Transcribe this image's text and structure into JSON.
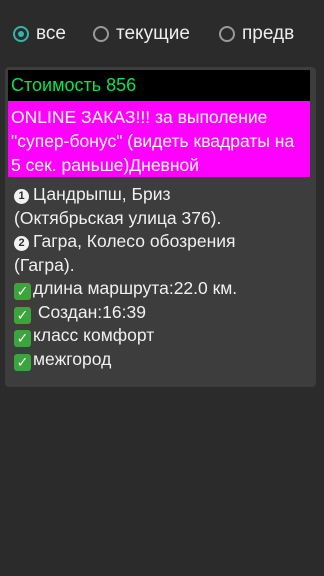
{
  "filters": {
    "options": [
      {
        "label": "все",
        "selected": true
      },
      {
        "label": "текущие",
        "selected": false
      },
      {
        "label": "предв",
        "selected": false
      }
    ]
  },
  "order": {
    "price_label": "Стоимость 856",
    "promo_text": "ONLINE ЗАКАЗ!!! за выполение \"супер-бонус\" (видеть квадраты на 5 сек. раньше)Дневной",
    "route": [
      {
        "marker": "1",
        "text_line1": "Цандрыпш, Бриз",
        "text_line2": "(Октябрьская улица 376)."
      },
      {
        "marker": "2",
        "text_line1": "Гагра, Колесо обозрения",
        "text_line2": "(Гагра)."
      }
    ],
    "info": {
      "distance": "длина маршрута:22.0 км.",
      "created": " Создан:16:39",
      "car_class": "класс комфорт",
      "trip_type": "межгород"
    }
  },
  "colors": {
    "background": "#2b2b2b",
    "card": "#3d3d3d",
    "price_bg": "#000000",
    "price_text": "#00e64d",
    "promo_bg": "#ff00ff",
    "radio_accent": "#33b5a8",
    "check_icon": "#3aa53a"
  },
  "icons": {
    "route_markers": "circled-number-icon",
    "info_markers": "check-mark-icon"
  }
}
